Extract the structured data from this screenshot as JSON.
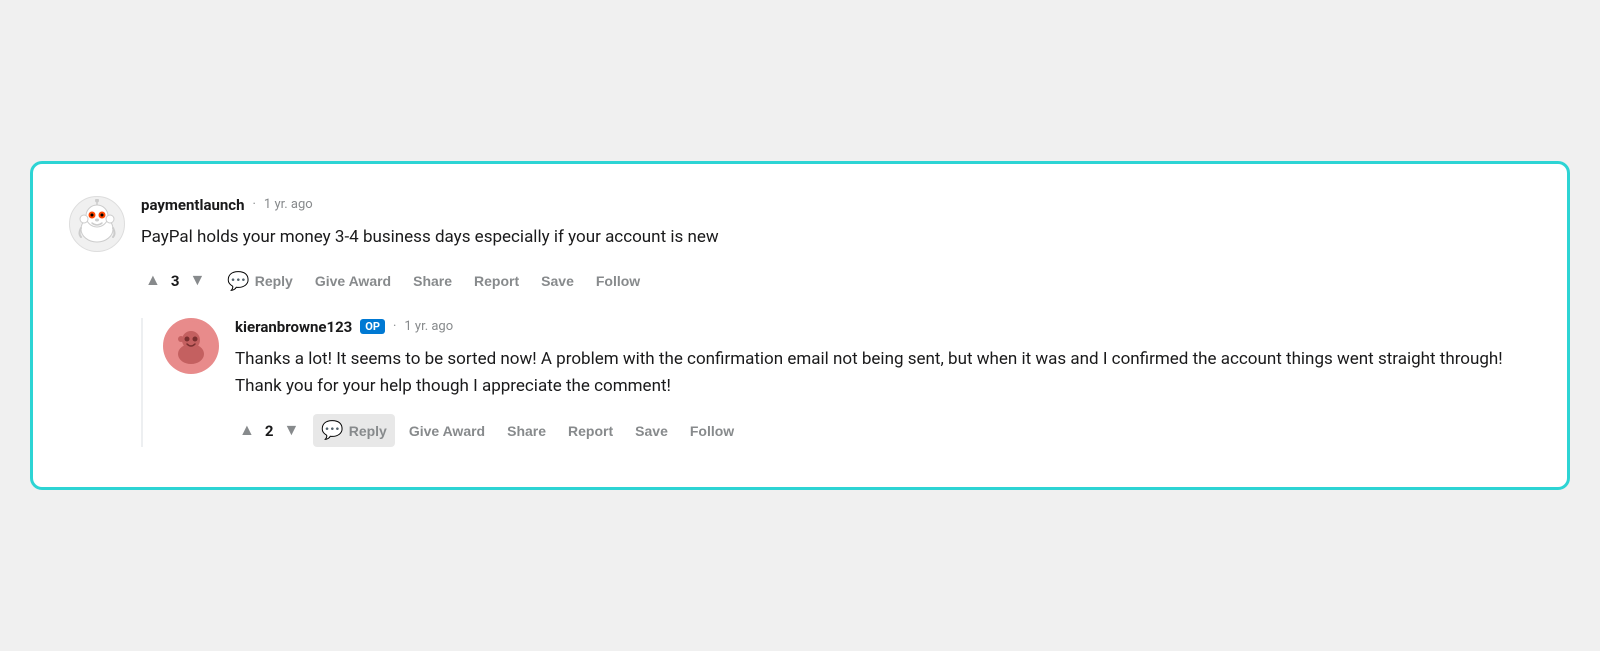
{
  "comments": [
    {
      "id": "comment1",
      "username": "paymentlaunch",
      "isOP": false,
      "timestamp": "1 yr. ago",
      "text": "PayPal holds your money 3-4 business days especially if your account is new",
      "votes": 3,
      "avatarType": "alien",
      "actions": {
        "reply": "Reply",
        "giveAward": "Give Award",
        "share": "Share",
        "report": "Report",
        "save": "Save",
        "follow": "Follow"
      }
    },
    {
      "id": "comment2",
      "username": "kieranbrowne123",
      "isOP": true,
      "opLabel": "OP",
      "timestamp": "1 yr. ago",
      "text": "Thanks a lot! It seems to be sorted now! A problem with the confirmation email not being sent, but when it was and I confirmed the account things went straight through! Thank you for your help though I appreciate the comment!",
      "votes": 2,
      "avatarType": "user",
      "actions": {
        "reply": "Reply",
        "giveAward": "Give Award",
        "share": "Share",
        "report": "Report",
        "save": "Save",
        "follow": "Follow"
      }
    }
  ],
  "dot": "·"
}
